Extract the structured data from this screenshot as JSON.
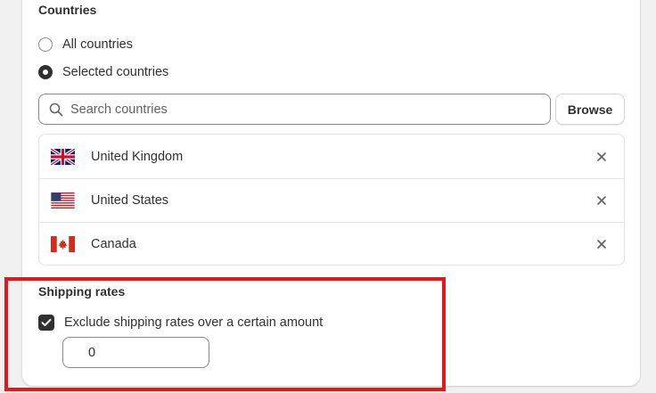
{
  "countries_section": {
    "title": "Countries",
    "options": [
      {
        "label": "All countries",
        "checked": false
      },
      {
        "label": "Selected countries",
        "checked": true
      }
    ],
    "search": {
      "placeholder": "Search countries",
      "value": ""
    },
    "browse_label": "Browse",
    "selected": [
      {
        "name": "United Kingdom",
        "flag": "uk-flag-icon"
      },
      {
        "name": "United States",
        "flag": "us-flag-icon"
      },
      {
        "name": "Canada",
        "flag": "canada-flag-icon"
      }
    ]
  },
  "shipping_rates": {
    "title": "Shipping rates",
    "exclude_label": "Exclude shipping rates over a certain amount",
    "exclude_checked": true,
    "amount_value": "0"
  },
  "colors": {
    "highlight": "#e0191f",
    "text": "#303030",
    "card": "#ffffff",
    "background": "#f1f1f1"
  }
}
